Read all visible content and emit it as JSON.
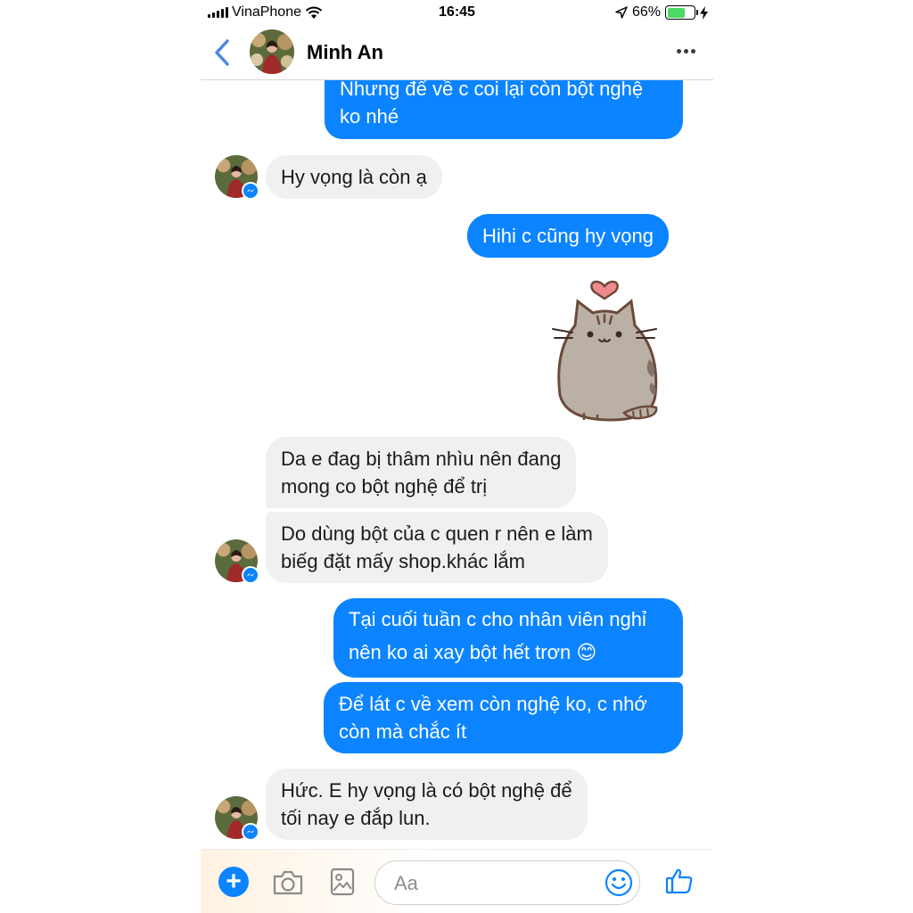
{
  "status_bar": {
    "carrier": "VinaPhone",
    "time": "16:45",
    "battery_percent": "66%",
    "battery_level": 0.66,
    "icons": [
      "signal-icon",
      "wifi-icon",
      "location-arrow-icon",
      "battery-icon",
      "charging-bolt-icon"
    ]
  },
  "header": {
    "contact_name": "Minh An",
    "icons": [
      "back-chevron-icon",
      "more-dots-icon"
    ]
  },
  "messages": [
    {
      "side": "out",
      "lines": [
        "Nhưng để về c coi lại còn bột nghệ",
        "ko nhé"
      ]
    },
    {
      "side": "in",
      "lines": [
        "Hy vọng là còn ạ"
      ]
    },
    {
      "side": "out",
      "lines": [
        "Hihi c cũng hy vọng"
      ]
    },
    {
      "side": "out",
      "sticker": "pusheen-cat-heart-sticker"
    },
    {
      "side": "in",
      "lines": [
        "Da e đag bị thâm nhìu nên đang",
        "mong co bột nghệ để trị"
      ]
    },
    {
      "side": "in",
      "lines": [
        "Do dùng bột của c quen r nên e làm",
        "biếg đặt mấy shop.khác lắm"
      ]
    },
    {
      "side": "out",
      "lines": [
        "Tại cuối tuần c cho nhân viên nghỉ",
        "nên ko ai xay bột hết trơn"
      ],
      "emoji": "😊"
    },
    {
      "side": "out",
      "lines": [
        "Để lát c về xem còn nghệ ko, c nhớ",
        "còn mà chắc ít"
      ]
    },
    {
      "side": "in",
      "lines": [
        "Hức. E hy vọng là có bột nghệ để",
        "tối nay e đắp lun."
      ]
    }
  ],
  "composer": {
    "placeholder": "Aa",
    "icons": [
      "plus-icon",
      "camera-icon",
      "photo-icon",
      "smiley-icon",
      "thumbs-up-icon"
    ]
  },
  "colors": {
    "outgoing_bubble": "#0c84ff",
    "incoming_bubble": "#f0f0f0",
    "accent": "#0c84ff"
  }
}
